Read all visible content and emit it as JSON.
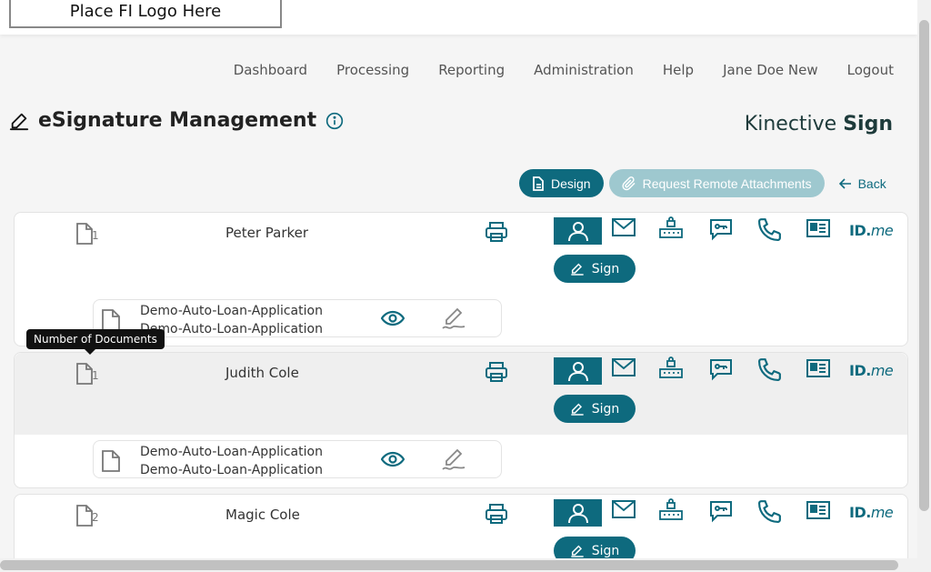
{
  "header": {
    "logo_text": "Place FI Logo Here"
  },
  "nav": {
    "items": [
      "Dashboard",
      "Processing",
      "Reporting",
      "Administration",
      "Help",
      "Jane Doe New",
      "Logout"
    ]
  },
  "page": {
    "title": "eSignature Management",
    "brand_light": "Kinective ",
    "brand_bold": "Sign"
  },
  "actions": {
    "design_label": "Design",
    "request_label": "Request Remote Attachments",
    "back_label": "Back"
  },
  "signers": [
    {
      "name": "Peter Parker",
      "doc_count": "1",
      "sign_label": "Sign",
      "documents": [
        {
          "line1": "Demo-Auto-Loan-Application",
          "line2": "Demo-Auto-Loan-Application"
        }
      ]
    },
    {
      "name": "Judith Cole",
      "doc_count": "1",
      "sign_label": "Sign",
      "documents": [
        {
          "line1": "Demo-Auto-Loan-Application",
          "line2": "Demo-Auto-Loan-Application"
        }
      ]
    },
    {
      "name": "Magic Cole",
      "doc_count": "2",
      "sign_label": "Sign",
      "documents": []
    }
  ],
  "auth_methods": {
    "idme_bold": "ID.",
    "idme_italic": "me"
  },
  "tooltip": {
    "text": "Number of Documents"
  },
  "colors": {
    "accent": "#0e6a7e",
    "accent_disabled": "#9ec8cf",
    "brand_text": "#1e3b3b"
  }
}
